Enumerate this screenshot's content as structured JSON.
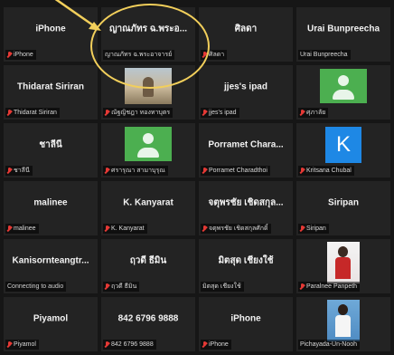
{
  "participants": [
    {
      "name": "iPhone",
      "label": "iPhone",
      "muted": true,
      "avatar": "none"
    },
    {
      "name": "ญาณภัทร ฉ.พระอ...",
      "label": "ญาณภัทร ฉ.พระอาจารย์",
      "muted": false,
      "avatar": "none"
    },
    {
      "name": "ศิลดา",
      "label": "ศิลดา",
      "muted": true,
      "avatar": "none"
    },
    {
      "name": "Urai Bunpreecha",
      "label": "Urai Bunpreecha",
      "muted": false,
      "avatar": "none"
    },
    {
      "name": "Thidarat Siriran",
      "label": "Thidarat Siriran",
      "muted": true,
      "avatar": "none"
    },
    {
      "name": "",
      "label": "ณัฐญิชฎา ทองทาบุตร",
      "muted": true,
      "avatar": "photo-landscape"
    },
    {
      "name": "jjes's ipad",
      "label": "jjes's ipad",
      "muted": true,
      "avatar": "none"
    },
    {
      "name": "",
      "label": "ศุภาลัย",
      "muted": true,
      "avatar": "generic"
    },
    {
      "name": "ชาลีนี",
      "label": "ชาลีนี",
      "muted": true,
      "avatar": "none"
    },
    {
      "name": "",
      "label": "ศรารุณา สามาบุรุณ",
      "muted": true,
      "avatar": "generic"
    },
    {
      "name": "Porramet Chara...",
      "label": "Porramet Charadthoi",
      "muted": true,
      "avatar": "none"
    },
    {
      "name": "",
      "label": "Kritsana Chubal",
      "muted": true,
      "avatar": "letter",
      "letter": "K"
    },
    {
      "name": "malinee",
      "label": "malinee",
      "muted": true,
      "avatar": "none"
    },
    {
      "name": "K. Kanyarat",
      "label": "K. Kanyarat",
      "muted": true,
      "avatar": "none"
    },
    {
      "name": "จตุพรชัย เชิดสกุล...",
      "label": "จตุพรชัย เชิดสกุลศักดิ์",
      "muted": true,
      "avatar": "none"
    },
    {
      "name": "Siripan",
      "label": "Siripan",
      "muted": true,
      "avatar": "none"
    },
    {
      "name": "Kanisornteangtr...",
      "label": "Connecting to audio",
      "muted": false,
      "avatar": "none",
      "status": true
    },
    {
      "name": "ฤวดี ธีมิน",
      "label": "ฤวดี ธีมิน",
      "muted": true,
      "avatar": "none"
    },
    {
      "name": "มิตสุด เชียงใช้",
      "label": "มิตสุด เชียงใช้",
      "muted": false,
      "avatar": "none"
    },
    {
      "name": "",
      "label": "Paralnee Panpeth",
      "muted": true,
      "avatar": "photo-person"
    },
    {
      "name": "Piyamol",
      "label": "Piyamol",
      "muted": true,
      "avatar": "none"
    },
    {
      "name": "842 6796 9888",
      "label": "842 6796 9888",
      "muted": true,
      "avatar": "none"
    },
    {
      "name": "iPhone",
      "label": "iPhone",
      "muted": true,
      "avatar": "none"
    },
    {
      "name": "",
      "label": "Pichayada-Un-Nooh",
      "muted": false,
      "avatar": "photo-person-blue"
    }
  ]
}
